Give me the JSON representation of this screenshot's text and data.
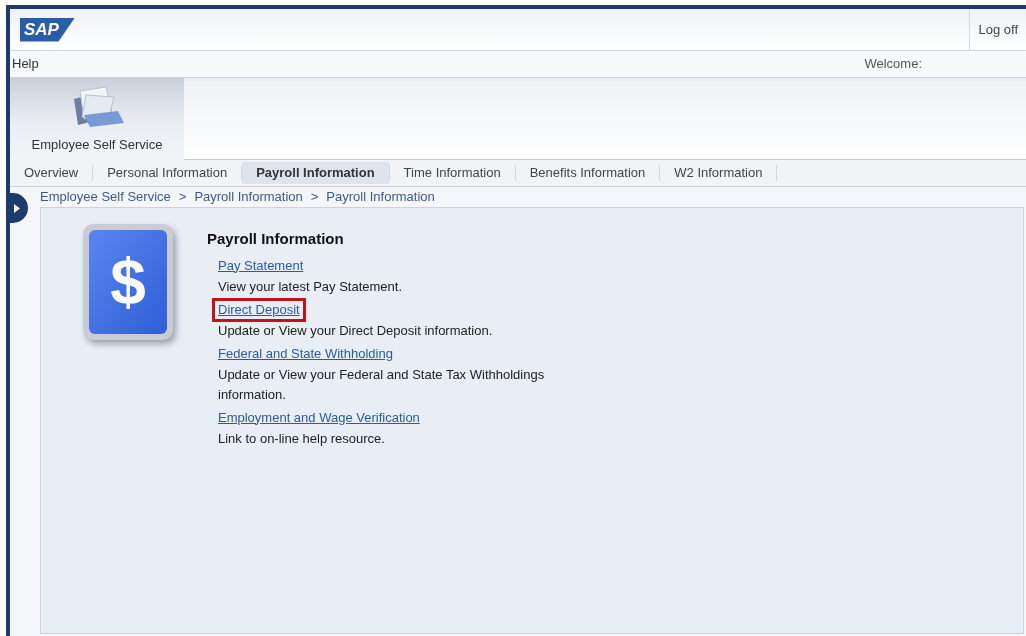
{
  "header": {
    "logo": "SAP",
    "logoff": "Log off"
  },
  "menu_bar": {
    "help": "Help",
    "welcome": "Welcome:"
  },
  "workset": {
    "label": "Employee Self Service"
  },
  "tabs": [
    {
      "label": "Overview",
      "selected": false
    },
    {
      "label": "Personal Information",
      "selected": false
    },
    {
      "label": "Payroll Information",
      "selected": true
    },
    {
      "label": "Time Information",
      "selected": false
    },
    {
      "label": "Benefits Information",
      "selected": false
    },
    {
      "label": "W2 Information",
      "selected": false
    }
  ],
  "breadcrumb": [
    "Employee Self Service",
    "Payroll Information",
    "Payroll Information"
  ],
  "breadcrumb_separator": ">",
  "content": {
    "icon_symbol": "$",
    "title": "Payroll Information",
    "items": [
      {
        "link": "Pay Statement",
        "description": "View your latest Pay Statement.",
        "highlighted": false
      },
      {
        "link": "Direct Deposit",
        "description": "Update or View your Direct Deposit information.",
        "highlighted": true
      },
      {
        "link": "Federal and State Withholding",
        "description": "Update or View your Federal and State Tax Withholdings information.",
        "highlighted": false
      },
      {
        "link": "Employment and Wage Verification",
        "description": "Link to on-line help resource.",
        "highlighted": false
      }
    ]
  }
}
